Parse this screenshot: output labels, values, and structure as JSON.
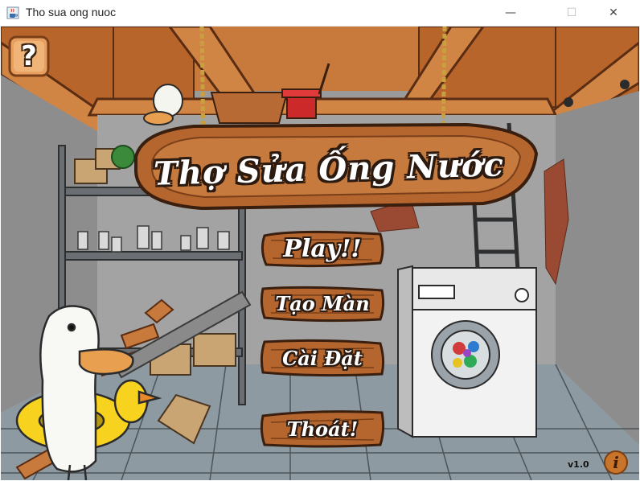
{
  "window": {
    "title": "Tho sua ong nuoc",
    "minimize_glyph": "—",
    "maximize_glyph": "☐",
    "close_glyph": "✕"
  },
  "game": {
    "title": "Thợ Sửa Ống Nước",
    "menu": {
      "play": "Play!!",
      "create_level": "Tạo Màn",
      "settings": "Cài Đặt",
      "quit": "Thoát!"
    },
    "help_glyph": "?",
    "info_glyph": "i",
    "version": "v1.0"
  },
  "icons": {
    "app": "java-cup-icon",
    "help": "question-mark-icon",
    "info": "info-icon"
  },
  "colors": {
    "wood": "#a0562a",
    "wood_dark": "#5a2c12",
    "sign_text": "#ffffff",
    "floor": "#8e9aa2",
    "wall": "#9b9b9b"
  }
}
